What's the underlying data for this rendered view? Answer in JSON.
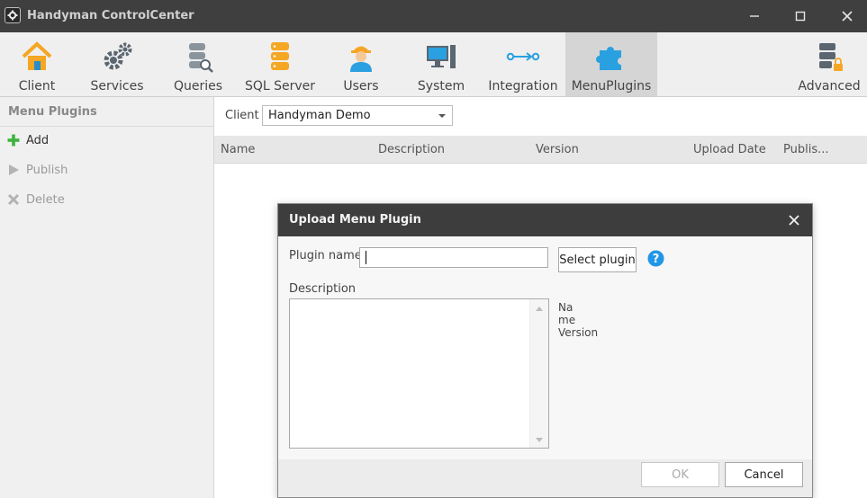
{
  "window": {
    "title": "Handyman ControlCenter",
    "app_icon": "gear-icon"
  },
  "ribbon": {
    "tabs": [
      {
        "label": "Client",
        "icon": "house-icon"
      },
      {
        "label": "Services",
        "icon": "gears-icon"
      },
      {
        "label": "Queries",
        "icon": "database-search-icon"
      },
      {
        "label": "SQL Server",
        "icon": "database-icon"
      },
      {
        "label": "Users",
        "icon": "user-worker-icon"
      },
      {
        "label": "System",
        "icon": "computer-icon"
      },
      {
        "label": "Integration",
        "icon": "integration-arrow-icon"
      },
      {
        "label": "MenuPlugins",
        "icon": "puzzle-icon",
        "active": true
      },
      {
        "label": "Advanced",
        "icon": "server-lock-icon"
      }
    ]
  },
  "left_panel": {
    "title": "Menu Plugins",
    "actions": [
      {
        "label": "Add",
        "icon": "plus-icon",
        "enabled": true
      },
      {
        "label": "Publish",
        "icon": "play-icon",
        "enabled": false
      },
      {
        "label": "Delete",
        "icon": "x-icon",
        "enabled": false
      }
    ]
  },
  "main": {
    "client_label": "Client",
    "client_value": "Handyman Demo",
    "columns": [
      "Name",
      "Description",
      "Version",
      "Upload Date",
      "Publis..."
    ]
  },
  "dialog": {
    "title": "Upload Menu Plugin",
    "plugin_name_label": "Plugin name",
    "plugin_name_value": "",
    "select_plugin_label": "Select plugin",
    "description_label": "Description",
    "description_value": "",
    "meta_name_label": "Name",
    "meta_version_label": "Version",
    "ok_label": "OK",
    "cancel_label": "Cancel"
  },
  "colors": {
    "titlebar": "#3f3f3f",
    "ribbon_icon_orange": "#f5a623",
    "ribbon_icon_blue": "#2aa0e0",
    "ribbon_icon_gray": "#5b6670",
    "add_green": "#3db33d",
    "help_blue": "#2296e6"
  }
}
